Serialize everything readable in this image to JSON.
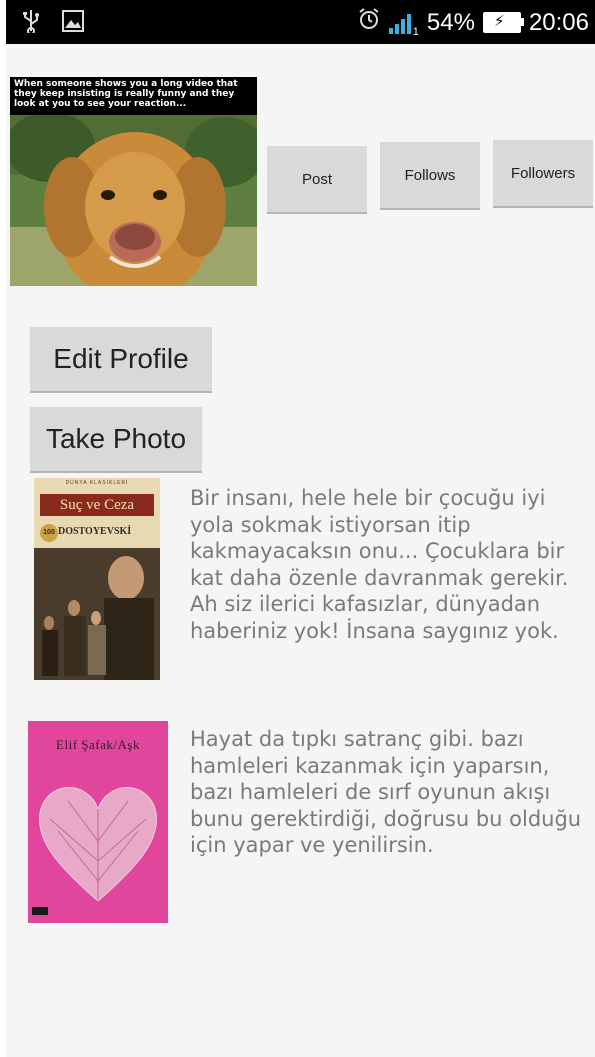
{
  "status_bar": {
    "battery_percent": "54%",
    "time": "20:06",
    "signal_sub": "1"
  },
  "hero": {
    "caption": "When someone shows you a long video that they keep insisting is really funny and they look at you to see your reaction..."
  },
  "stats_buttons": {
    "post": "Post",
    "follows": "Follows",
    "followers": "Followers"
  },
  "actions": {
    "edit_profile": "Edit Profile",
    "take_photo": "Take Photo"
  },
  "books": [
    {
      "cover_series": "DÜNYA KLASİKLERİ",
      "cover_title": "Suç ve Ceza",
      "cover_author": "DOSTOYEVSKİ",
      "quote": "Bir insanı, hele hele bir çocuğu iyi yola sokmak istiyorsan itip kakmayacaksın onu... Çocuklara bir kat daha özenle davranmak gerekir. Ah siz ilerici kafasızlar, dünyadan haberiniz yok! İnsana saygınız yok."
    },
    {
      "cover_title": "Elif Şafak/Aşk",
      "quote": "Hayat da tıpkı satranç gibi. bazı hamleleri kazanmak için yaparsın, bazı hamleleri de sırf oyunun akışı bunu gerektirdiği, doğrusu bu olduğu için yapar ve yenilirsin."
    }
  ],
  "colors": {
    "background": "#f5f5f5",
    "button": "#d9d9d9",
    "quote_text": "#7a7a7a",
    "signal": "#36b3e6",
    "aşk_cover": "#e0479c"
  }
}
